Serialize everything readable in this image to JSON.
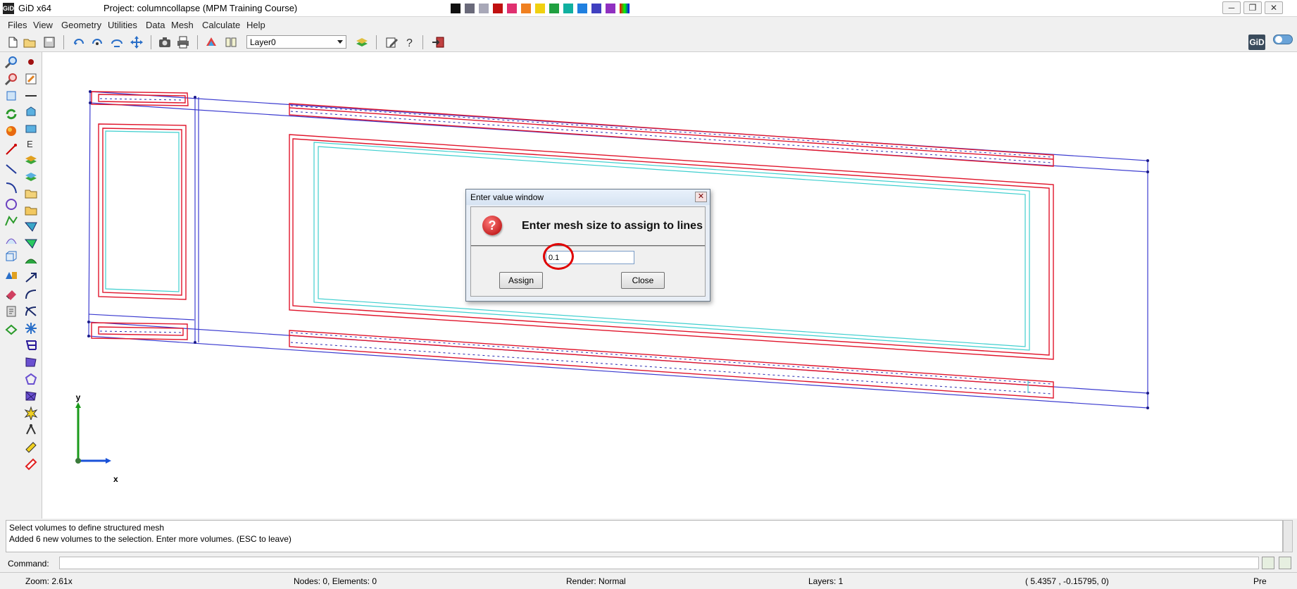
{
  "window": {
    "app_icon_text": "GiD",
    "app_name": "GiD x64",
    "project_title": "Project: columncollapse (MPM Training Course)",
    "controls": [
      "─",
      "❐",
      "✕"
    ]
  },
  "menu": [
    "Files",
    "View",
    "Geometry",
    "Utilities",
    "Data",
    "Mesh",
    "Calculate",
    "Help"
  ],
  "toolbar": {
    "layer_value": "Layer0",
    "gid_badge": "GiD",
    "icons": [
      "new-file-icon",
      "open-folder-icon",
      "save-icon",
      "rotate-icon",
      "rotate-center-icon",
      "zoom-frame-icon",
      "pan-icon",
      "camera-icon",
      "print-icon",
      "render-icon",
      "view-icon",
      "layers-icon",
      "edit-icon",
      "help-icon",
      "exit-icon"
    ]
  },
  "palette": {
    "left_icons": [
      "zoom-in-icon",
      "zoom-out-icon",
      "zoom-frame-icon",
      "redraw-icon",
      "render-icon",
      "point-icon",
      "line-icon",
      "arc-icon",
      "circle-icon",
      "polyline-icon",
      "surface-icon",
      "volume-icon",
      "shapes-icon",
      "eraser-icon",
      "measure-icon",
      "mesh-surface-icon"
    ],
    "right_icons": [
      "point-create-icon",
      "edit-pencil-icon",
      "line-create-icon",
      "box-icon",
      "rectangle-icon",
      "text-icon",
      "layers-icon",
      "layers-alt-icon",
      "folder-icon",
      "folder-open-icon",
      "structured-mesh-icon",
      "assign-sizes-icon",
      "surface-mesh-icon",
      "move-icon",
      "nurbs-icon",
      "copy-icon",
      "divide-icon",
      "grid-icon",
      "hexa-icon",
      "boundary-icon",
      "tetra-icon",
      "explode-icon",
      "collapse-icon",
      "repair-icon",
      "mesh-draw-icon"
    ]
  },
  "dialog": {
    "title": "Enter value window",
    "close_glyph": "✕",
    "icon_glyph": "?",
    "message": "Enter mesh size to assign to lines",
    "input_value": "0.1",
    "assign_label": "Assign",
    "close_label": "Close"
  },
  "canvas": {
    "axis_y": "y",
    "axis_x": "x"
  },
  "console": {
    "lines": [
      "Select volumes to define structured mesh",
      "Added 6 new  volumes to the selection. Enter more volumes. (ESC to leave)"
    ]
  },
  "command": {
    "label": "Command:"
  },
  "status": {
    "zoom": "Zoom: 2.61x",
    "nodes": "Nodes: 0, Elements: 0",
    "render": "Render: Normal",
    "layers": "Layers: 1",
    "coords": "( 5.4357 , -0.15795,  0)",
    "mode": "Pre"
  },
  "colors": {
    "geometry_red": "#e0152b",
    "geometry_cyan": "#3fcfcf",
    "geometry_blue": "#3c3cd0",
    "axis_green": "#1a9a1a",
    "axis_blue": "#1a52d8"
  }
}
